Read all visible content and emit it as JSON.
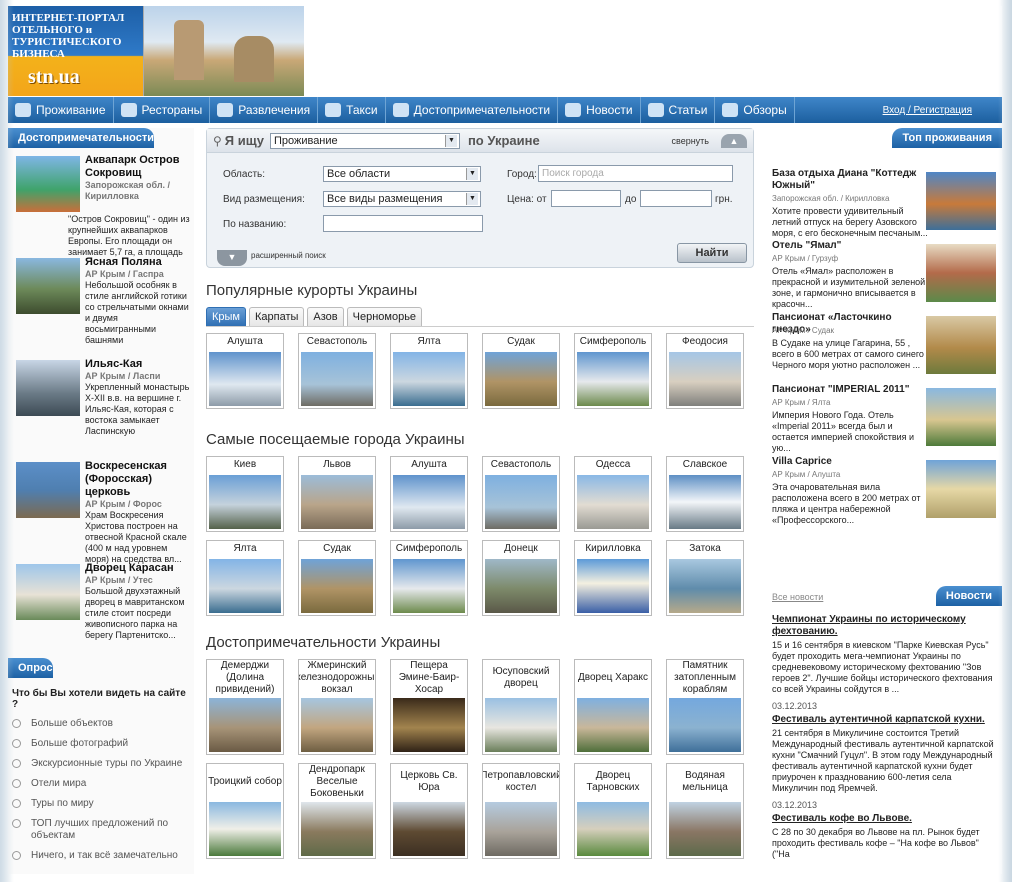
{
  "header": {
    "logo_line1": "ИНТЕРНЕТ-ПОРТАЛ ОТЕЛЬНОГО и ТУРИСТИЧЕСКОГО БИЗНЕСА",
    "logo_site": "stn.ua"
  },
  "nav": {
    "items": [
      {
        "label": "Проживание",
        "icon": "bed-icon"
      },
      {
        "label": "Рестораны",
        "icon": "dish-icon"
      },
      {
        "label": "Развлечения",
        "icon": "fun-icon"
      },
      {
        "label": "Такси",
        "icon": "taxi-icon"
      },
      {
        "label": "Достопримечательности",
        "icon": "landmark-icon"
      },
      {
        "label": "Новости",
        "icon": "news-icon"
      },
      {
        "label": "Статьи",
        "icon": "article-icon"
      },
      {
        "label": "Обзоры",
        "icon": "review-icon"
      }
    ],
    "login": "Вход / Регистрация"
  },
  "left": {
    "title": "Достопримечательности",
    "sights": [
      {
        "title": "Аквапарк Остров Сокровищ",
        "loc": "Запорожская обл. / Кирилловка",
        "desc": "\"Остров Сокровищ\" - один из крупнейших аквапарков Европы. Его площади он занимает 5,7 га, а площадь"
      },
      {
        "title": "Ясная Поляна",
        "loc": "АР Крым / Гаспра",
        "desc": "Небольшой особняк в стиле английской готики со стрельчатыми окнами и двумя восьмигранными башнями"
      },
      {
        "title": "Ильяс-Кая",
        "loc": "АР Крым / Ласпи",
        "desc": "Укрепленный монастырь X-XII в.в. на вершине г. Ильяс-Кая, которая с востока замыкает Ласпинскую"
      },
      {
        "title": "Воскресенская (Форосская) церковь",
        "loc": "АР Крым / Форос",
        "desc": "Храм Воскресения Христова построен на отвесной Красной скале (400 м над уровнем моря) на средства вл..."
      },
      {
        "title": "Дворец Карасан",
        "loc": "АР Крым / Утес",
        "desc": "Большой двухэтажный дворец в мавританском стиле стоит посреди живописного парка на берегу Партенитско..."
      }
    ],
    "poll_title": "Опрос",
    "poll_question": "Что бы Вы хотели видеть на сайте ?",
    "poll_options": [
      "Больше объектов",
      "Больше фотографий",
      "Экскурсионные туры по Украине",
      "Отели мира",
      "Туры по миру",
      "ТОП лучших предложений по объектам",
      "Ничего, и так всё замечательно"
    ]
  },
  "search": {
    "label1": "Я ищу",
    "type_value": "Проживание",
    "label2": "по Украине",
    "collapse": "свернуть",
    "region_label": "Область:",
    "region_value": "Все области",
    "accom_label": "Вид размещения:",
    "accom_value": "Все виды размещения",
    "name_label": "По названию:",
    "city_label": "Город:",
    "city_placeholder": "Поиск города",
    "price_label": "Цена: от",
    "price_to": "до",
    "currency": "грн.",
    "advanced": "расширенный поиск",
    "find": "Найти"
  },
  "resorts": {
    "title": "Популярные курорты Украины",
    "tabs": [
      "Крым",
      "Карпаты",
      "Азов",
      "Черноморье"
    ],
    "items": [
      "Алушта",
      "Севастополь",
      "Ялта",
      "Судак",
      "Симферополь",
      "Феодосия"
    ]
  },
  "cities": {
    "title": "Самые посещаемые города Украины",
    "items": [
      "Киев",
      "Львов",
      "Алушта",
      "Севастополь",
      "Одесса",
      "Славское",
      "Ялта",
      "Судак",
      "Симферополь",
      "Донецк",
      "Кирилловка",
      "Затока"
    ]
  },
  "attractions": {
    "title": "Достопримечательности Украины",
    "items": [
      "Демерджи (Долина привидений)",
      "Жмеринский железнодорожный вокзал",
      "Пещера Эмине-Баир-Хосар",
      "Юсуповский дворец",
      "Дворец Харакс",
      "Памятник затопленным кораблям",
      "Троицкий собор",
      "Дендропарк Веселые Боковеньки",
      "Церковь Св. Юра",
      "Петропавловский костел",
      "Дворец Тарновских",
      "Водяная мельница"
    ]
  },
  "right": {
    "title": "Топ проживания",
    "hotels": [
      {
        "title": "База отдыха Диана \"Коттедж Южный\"",
        "loc": "Запорожская обл. / Кирилловка",
        "desc": "Хотите провести удивительный летний отпуск на берегу Азовского моря, с его бесконечным песчаным..."
      },
      {
        "title": "Отель \"Ямал\"",
        "loc": "АР Крым / Гурзуф",
        "desc": "Отель «Ямал» расположен в прекрасной и изумительной зеленой зоне, и гармонично вписывается в красочн..."
      },
      {
        "title": "Пансионат «Ласточкино гнездо»",
        "loc": "АР Крым / Судак",
        "desc": "В Судаке на улице Гагарина, 55 , всего в 600 метрах от самого синего Черного моря уютно расположен ..."
      },
      {
        "title": "Пансионат \"IMPERIAL 2011\"",
        "loc": "АР Крым / Ялта",
        "desc": "Империя Нового Года. Отель «Imperial 2011» всегда был и остается империей спокойствия и ую..."
      },
      {
        "title": "Villa Caprice",
        "loc": "АР Крым / Алушта",
        "desc": "Эта очаровательная вила расположена всего в 200 метрах от пляжа и центра набережной «Профессорского..."
      }
    ],
    "news_title": "Новости",
    "all_news": "Все новости",
    "news": [
      {
        "title": "Чемпионат Украины по историческому фехтованию.",
        "text": "15 и 16 сентября в киевском \"Парке Киевская Русь\" будет проходить мега-чемпионат Украины по средневековому историческому фехтованию \"Зов героев 2\". Лучшие бойцы исторического фехтования со всей Украины сойдутся в ..."
      },
      {
        "date": "03.12.2013",
        "title": "Фестиваль аутентичной карпатской кухни.",
        "text": "21 сентября в Микуличине состоится Третий Международный фестиваль аутентичной карпатской кухни \"Смачний Гуцул\". В этом году Международный фестиваль аутентичной карпатской кухни будет приурочен к празднованию 600-летия села Микуличин под Яремчей."
      },
      {
        "date": "03.12.2013",
        "title": "Фестиваль кофе во Львове.",
        "text": "С 28 по 30 декабря во Львове на пл. Рынок будет проходить фестиваль кофе – \"На кофе во Львов\" (\"На"
      }
    ]
  },
  "colors": {
    "nav": "#1c5f9f",
    "accent": "#2f7ac8",
    "logo_orange": "#f3a51a"
  }
}
